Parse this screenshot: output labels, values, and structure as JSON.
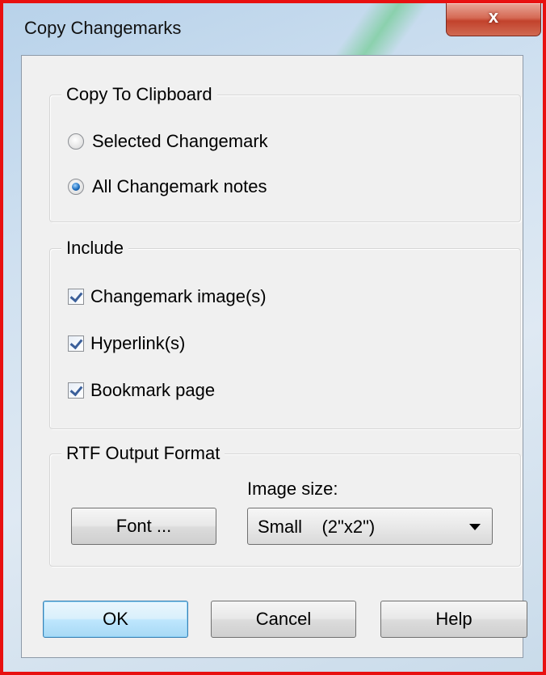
{
  "window": {
    "title": "Copy Changemarks",
    "close_label": "x"
  },
  "copy_group": {
    "title": "Copy To Clipboard",
    "options": [
      {
        "label": "Selected Changemark",
        "checked": false
      },
      {
        "label": "All Changemark notes",
        "checked": true
      }
    ]
  },
  "include_group": {
    "title": "Include",
    "items": [
      {
        "label": "Changemark image(s)",
        "checked": true
      },
      {
        "label": "Hyperlink(s)",
        "checked": true
      },
      {
        "label": "Bookmark page",
        "checked": true
      }
    ]
  },
  "rtf_group": {
    "title": "RTF Output Format",
    "font_button": "Font ...",
    "image_size_label": "Image size:",
    "image_size_value": "Small    (2\"x2\")"
  },
  "buttons": {
    "ok": "OK",
    "cancel": "Cancel",
    "help": "Help"
  }
}
